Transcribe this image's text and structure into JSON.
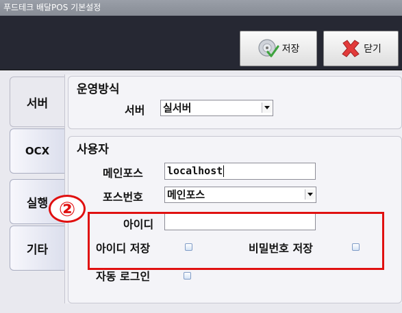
{
  "window": {
    "title": "푸드테크 배달POS 기본설정"
  },
  "toolbar": {
    "save_label": "저장",
    "close_label": "닫기"
  },
  "tabs": {
    "server": "서버",
    "ocx": "OCX",
    "run": "실행",
    "etc": "기타"
  },
  "operation": {
    "title": "운영방식",
    "server_label": "서버",
    "server_value": "실서버"
  },
  "user": {
    "title": "사용자",
    "mainpos_label": "메인포스",
    "mainpos_value": "localhost",
    "posno_label": "포스번호",
    "posno_value": "메인포스",
    "id_label": "아이디",
    "id_value": "",
    "save_id_label": "아이디 저장",
    "save_pw_label": "비밀번호 저장",
    "autologin_label": "자동 로그인"
  },
  "annotation": {
    "marker": "②",
    "color": "#e01010"
  }
}
